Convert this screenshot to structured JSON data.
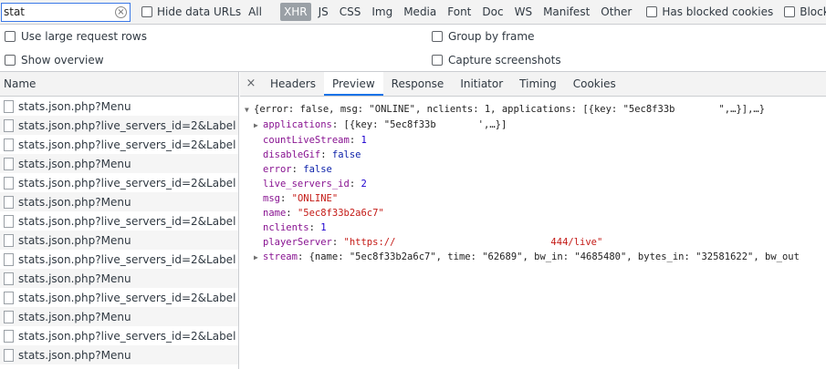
{
  "filter": {
    "search_value": "stat",
    "hide_data_urls": "Hide data URLs",
    "types": [
      "All",
      "XHR",
      "JS",
      "CSS",
      "Img",
      "Media",
      "Font",
      "Doc",
      "WS",
      "Manifest",
      "Other"
    ],
    "active_type": "XHR",
    "has_blocked_cookies": "Has blocked cookies",
    "blocked_requests": "Blocked Requests"
  },
  "options": {
    "large_rows": "Use large request rows",
    "show_overview": "Show overview",
    "group_by_frame": "Group by frame",
    "capture_screenshots": "Capture screenshots"
  },
  "requests": {
    "header": "Name",
    "rows": [
      "stats.json.php?Menu",
      "stats.json.php?live_servers_id=2&Label",
      "stats.json.php?live_servers_id=2&Label",
      "stats.json.php?Menu",
      "stats.json.php?live_servers_id=2&Label",
      "stats.json.php?Menu",
      "stats.json.php?live_servers_id=2&Label",
      "stats.json.php?Menu",
      "stats.json.php?live_servers_id=2&Label",
      "stats.json.php?Menu",
      "stats.json.php?live_servers_id=2&Label",
      "stats.json.php?Menu",
      "stats.json.php?live_servers_id=2&Label",
      "stats.json.php?Menu"
    ]
  },
  "details": {
    "close": "×",
    "tabs": [
      "Headers",
      "Preview",
      "Response",
      "Initiator",
      "Timing",
      "Cookies"
    ],
    "selected_tab": "Preview"
  },
  "preview": {
    "summary": "{error: false, msg: \"ONLINE\", nclients: 1, applications: [{key: \"5ec8f33b",
    "summary_tail": "\",…}],…}",
    "applications_key": "applications",
    "applications_val": "[{key: \"5ec8f33b",
    "applications_tail": "',…}]",
    "countLiveStream_key": "countLiveStream",
    "countLiveStream_val": "1",
    "disableGif_key": "disableGif",
    "disableGif_val": "false",
    "error_key": "error",
    "error_val": "false",
    "live_servers_id_key": "live_servers_id",
    "live_servers_id_val": "2",
    "msg_key": "msg",
    "msg_val": "\"ONLINE\"",
    "name_key": "name",
    "name_val": "\"5ec8f33b2a6c7\"",
    "nclients_key": "nclients",
    "nclients_val": "1",
    "playerServer_key": "playerServer",
    "playerServer_val_start": "\"https://",
    "playerServer_val_end": "444/live\"",
    "stream_key": "stream",
    "stream_val": "{name: \"5ec8f33b2a6c7\", time: \"62689\", bw_in: \"4685480\", bytes_in: \"32581622\", bw_out"
  }
}
